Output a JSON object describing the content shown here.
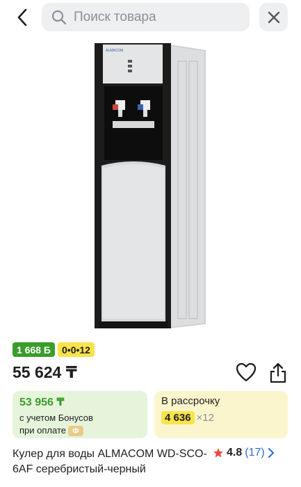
{
  "search": {
    "placeholder": "Поиск товара"
  },
  "badges": {
    "bonus": "1 668 Б",
    "installment_plan": "0•0•12"
  },
  "product": {
    "price": "55 624 ₸",
    "title": "Кулер для воды ALMACOM WD-SCO-6AF серебристый-черный",
    "image_brand_text": "ALMACOM"
  },
  "bonus_card": {
    "amount": "53 956 ₸",
    "line1": "с учетом Бонусов",
    "line2": "при оплате"
  },
  "installment_card": {
    "title": "В рассрочку",
    "monthly": "4 636",
    "multiplier": "×12"
  },
  "rating": {
    "score": "4.8",
    "reviews": "(17)"
  },
  "colors": {
    "accent_green": "#3a9d2b",
    "accent_yellow": "#f8e34a",
    "link_blue": "#2d6bd6",
    "star_red": "#e84a3d"
  }
}
